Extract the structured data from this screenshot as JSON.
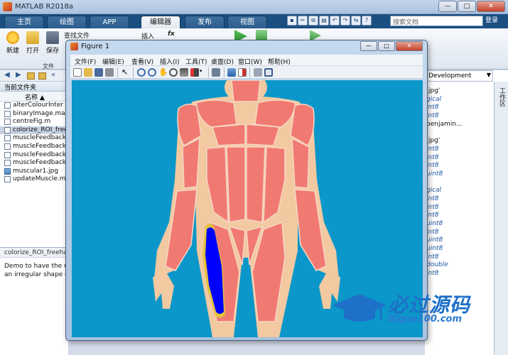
{
  "window": {
    "title": "MATLAB R2018a"
  },
  "ribbon_tabs": [
    "主页",
    "绘图",
    "APP",
    "编辑器",
    "发布",
    "视图"
  ],
  "search": {
    "placeholder": "搜索文档",
    "button": "登录"
  },
  "ribbon": {
    "new_label": "新建",
    "open_label": "打开",
    "save_label": "保存",
    "find_files_label": "查找文件",
    "insert_label": "插入",
    "file_group_label": "文件"
  },
  "folder_panel": {
    "title": "当前文件夹",
    "column_name": "名称",
    "files": [
      {
        "name": "alterColourInter",
        "kind": "m"
      },
      {
        "name": "binaryImage.mat",
        "kind": "m"
      },
      {
        "name": "centreFig.m",
        "kind": "m"
      },
      {
        "name": "colorize_ROI_free",
        "kind": "m",
        "selected": true
      },
      {
        "name": "muscleFeedback",
        "kind": "m"
      },
      {
        "name": "muscleFeedback",
        "kind": "m"
      },
      {
        "name": "muscleFeedback",
        "kind": "m"
      },
      {
        "name": "muscleFeedback",
        "kind": "m"
      },
      {
        "name": "muscular1.jpg",
        "kind": "img"
      },
      {
        "name": "updateMuscle.m",
        "kind": "m"
      }
    ],
    "details_header": "colorize_ROI_freehand",
    "details_lines": [
      "Demo to have the us",
      "an irregular shape ov"
    ]
  },
  "workspace": {
    "combo": "Development",
    "side_label": "工作区",
    "rows": [
      {
        "text": ".jpg'",
        "cls": "str"
      },
      {
        "text": "gical",
        "cls": "cls"
      },
      {
        "text": "int8",
        "cls": "cls"
      },
      {
        "text": "int8",
        "cls": "cls"
      },
      {
        "text": "benjamin...",
        "cls": "str"
      },
      {
        "text": "",
        "cls": "str"
      },
      {
        "text": ".jpg'",
        "cls": "str"
      },
      {
        "text": "int8",
        "cls": "cls"
      },
      {
        "text": "int8",
        "cls": "cls"
      },
      {
        "text": "int8",
        "cls": "cls"
      },
      {
        "text": "uint8",
        "cls": "cls"
      },
      {
        "text": "",
        "cls": "str"
      },
      {
        "text": "gical",
        "cls": "cls"
      },
      {
        "text": "int8",
        "cls": "cls"
      },
      {
        "text": "int8",
        "cls": "cls"
      },
      {
        "text": "int8",
        "cls": "cls"
      },
      {
        "text": "uint8",
        "cls": "cls"
      },
      {
        "text": "int8",
        "cls": "cls"
      },
      {
        "text": "uint8",
        "cls": "cls"
      },
      {
        "text": "uint8",
        "cls": "cls"
      },
      {
        "text": "int8",
        "cls": "cls"
      },
      {
        "text": "double",
        "cls": "cls"
      },
      {
        "text": "int8",
        "cls": "cls"
      }
    ]
  },
  "figure": {
    "title": "Figure 1",
    "menus": [
      "文件(F)",
      "编辑(E)",
      "查看(V)",
      "插入(I)",
      "工具(T)",
      "桌面(D)",
      "窗口(W)",
      "帮助(H)"
    ]
  },
  "watermark": {
    "title": "必过源码",
    "subtitle": "Bigue100.com"
  },
  "colors": {
    "canvas": "#0b97c9",
    "muscle": "#f07a72",
    "skin": "#f2c9a0",
    "highlight": "#0000ff",
    "accent": "#1b4f82"
  }
}
